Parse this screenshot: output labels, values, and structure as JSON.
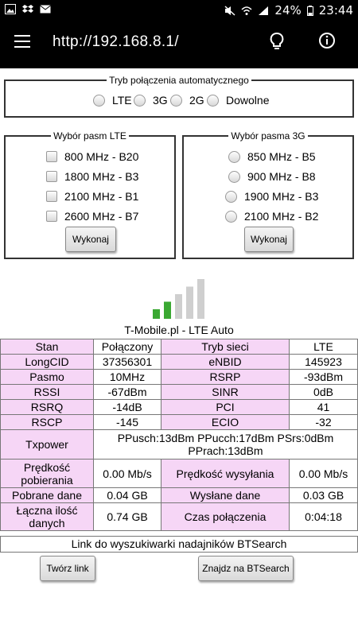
{
  "status": {
    "battery": "24%",
    "time": "23:44"
  },
  "browser": {
    "url": "http://192.168.8.1/"
  },
  "mode": {
    "legend": "Tryb połączenia automatycznego",
    "options": [
      "LTE",
      "3G",
      "2G",
      "Dowolne"
    ]
  },
  "lte": {
    "legend": "Wybór pasm LTE",
    "bands": [
      "800 MHz - B20",
      "1800 MHz - B3",
      "2100 MHz - B1",
      "2600 MHz - B7"
    ],
    "button": "Wykonaj"
  },
  "umts": {
    "legend": "Wybór pasma 3G",
    "bands": [
      "850 MHz - B5",
      "900 MHz - B8",
      "1900 MHz - B3",
      "2100 MHz - B2"
    ],
    "button": "Wykonaj"
  },
  "signal": {
    "bars_active": 2,
    "bars_total": 5,
    "active_color": "#3aa832",
    "inactive_color": "#cfcfcf"
  },
  "operator": "T-Mobile.pl - LTE Auto",
  "table": {
    "stan": {
      "label": "Stan",
      "value": "Połączony"
    },
    "tryb": {
      "label": "Tryb sieci",
      "value": "LTE"
    },
    "longcid": {
      "label": "LongCID",
      "value": "37356301"
    },
    "enbid": {
      "label": "eNBID",
      "value": "145923"
    },
    "pasmo": {
      "label": "Pasmo",
      "value": "10MHz"
    },
    "rsrp": {
      "label": "RSRP",
      "value": "-93dBm"
    },
    "rssi": {
      "label": "RSSI",
      "value": "-67dBm"
    },
    "sinr": {
      "label": "SINR",
      "value": "0dB"
    },
    "rsrq": {
      "label": "RSRQ",
      "value": "-14dB"
    },
    "pci": {
      "label": "PCI",
      "value": "41"
    },
    "rscp": {
      "label": "RSCP",
      "value": "-145"
    },
    "ecio": {
      "label": "ECIO",
      "value": "-32"
    },
    "txpower": {
      "label": "Txpower",
      "value": "PPusch:13dBm PPucch:17dBm PSrs:0dBm PPrach:13dBm"
    },
    "download": {
      "label": "Prędkość pobierania",
      "value": "0.00 Mb/s"
    },
    "upload": {
      "label": "Prędkość wysyłania",
      "value": "0.00 Mb/s"
    },
    "downloaded": {
      "label": "Pobrane dane",
      "value": "0.04 GB"
    },
    "uploaded": {
      "label": "Wysłane dane",
      "value": "0.03 GB"
    },
    "total": {
      "label": "Łączna ilość danych",
      "value": "0.74 GB"
    },
    "time": {
      "label": "Czas połączenia",
      "value": "0:04:18"
    }
  },
  "btsearch_link": "Link do wyszukiwarki nadajników BTSearch",
  "buttons": {
    "create_link": "Twórz link",
    "find": "Znajdz na BTSearch"
  }
}
